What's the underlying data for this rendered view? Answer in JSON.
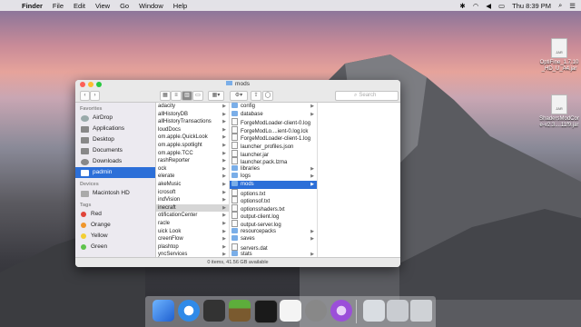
{
  "menubar": {
    "app": "Finder",
    "items": [
      "File",
      "Edit",
      "View",
      "Go",
      "Window",
      "Help"
    ],
    "clock": "Thu 8:39 PM"
  },
  "desktop_icons": [
    {
      "label_line1": "OptiFine_1.7.10",
      "label_line2": "_HD_U_A4.jar",
      "badge": "JAR"
    },
    {
      "label_line1": "ShadersModCor",
      "label_line2": "e-v2.3....11f9.jar",
      "badge": "JAR"
    }
  ],
  "window": {
    "title": "mods",
    "search_placeholder": "Search",
    "status": "0 items, 41.56 GB available"
  },
  "sidebar": {
    "favorites_header": "Favorites",
    "favorites": [
      "AirDrop",
      "Applications",
      "Desktop",
      "Documents",
      "Downloads",
      "padmin"
    ],
    "devices_header": "Devices",
    "devices": [
      "Macintosh HD"
    ],
    "tags_header": "Tags",
    "tags": [
      {
        "label": "Red",
        "color": "#e0443a"
      },
      {
        "label": "Orange",
        "color": "#f0962b"
      },
      {
        "label": "Yellow",
        "color": "#f3cf33"
      },
      {
        "label": "Green",
        "color": "#5ec34b"
      }
    ]
  },
  "column1": [
    "adacity",
    "allHistoryDB",
    "allHistoryTransactions",
    "loudDocs",
    "om.apple.QuickLook",
    "om.apple.spotlight",
    "om.apple.TCC",
    "rashReporter",
    "ock",
    "elerate",
    "akeMusic",
    "icrosoft",
    "indVision",
    "inecraft",
    "otificationCenter",
    "racle",
    "uick Look",
    "creenFlow",
    "plashtop",
    "yncServices"
  ],
  "column1_selected": 13,
  "column2": [
    "config",
    "database",
    "ForgeModLoader-client-0.log",
    "ForgeModLo....ient-0.log.lck",
    "ForgeModLoader-client-1.log",
    "launcher_profiles.json",
    "launcher.jar",
    "launcher.pack.lzma",
    "libraries",
    "logs",
    "mods",
    "options.txt",
    "optionsof.txt",
    "optionsshaders.txt",
    "output-client.log",
    "output-server.log",
    "resourcepacks",
    "saves",
    "servers.dat",
    "stats"
  ],
  "column2_folders": [
    0,
    1,
    8,
    9,
    10,
    16,
    17,
    19
  ],
  "column2_selected": 10
}
